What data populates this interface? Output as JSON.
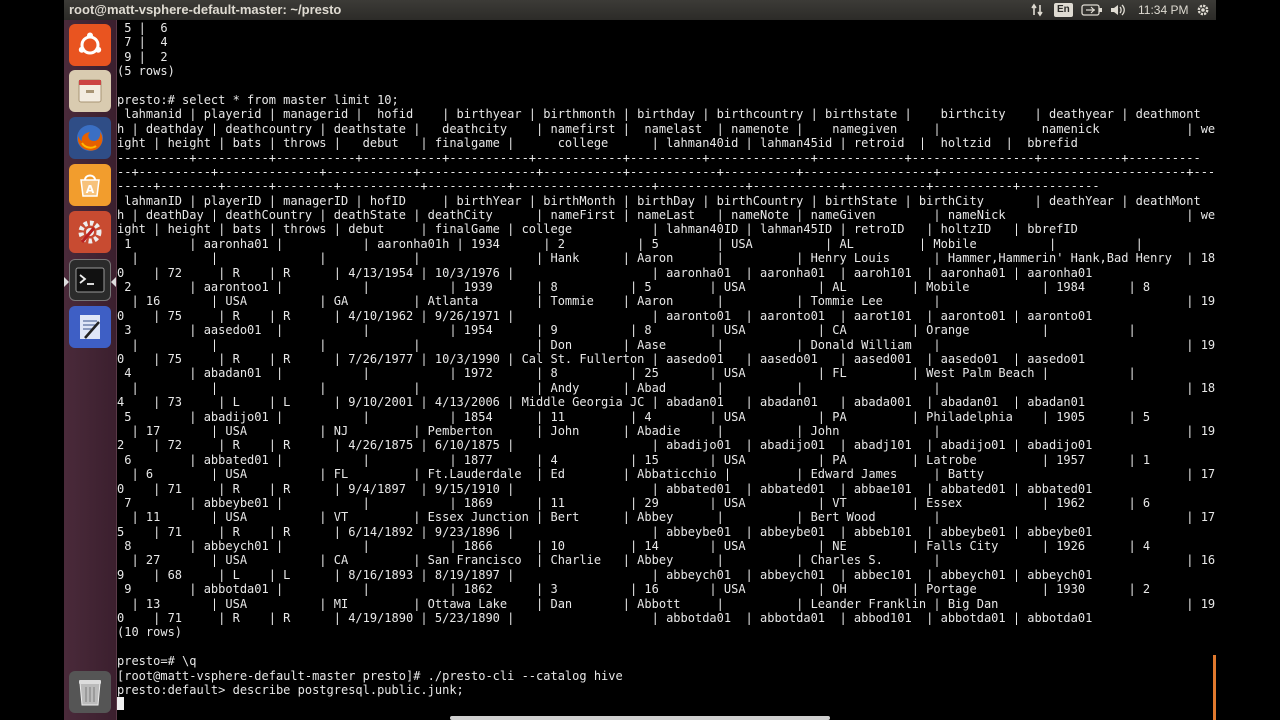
{
  "window": {
    "title": "root@matt-vsphere-default-master: ~/presto"
  },
  "tray": {
    "keyboard_layout": "En",
    "time": "11:34 PM",
    "icons": [
      "network-arrows-icon",
      "keyboard-layout-icon",
      "battery-icon",
      "volume-icon",
      "gear-icon"
    ]
  },
  "launcher": {
    "items": [
      {
        "name": "ubuntu-dash",
        "icon": "ubuntu-logo-icon",
        "color": "#e95420"
      },
      {
        "name": "files",
        "icon": "file-cabinet-icon",
        "color": "#d9cbb0"
      },
      {
        "name": "firefox",
        "icon": "firefox-icon",
        "color": "#e66000"
      },
      {
        "name": "software-center",
        "icon": "software-center-icon",
        "color": "#f29d2d"
      },
      {
        "name": "system-settings",
        "icon": "settings-icon",
        "color": "#c84b31"
      },
      {
        "name": "terminal",
        "icon": "terminal-icon",
        "color": "#2b2b2b"
      },
      {
        "name": "text-editor",
        "icon": "text-editor-icon",
        "color": "#3e5fc5"
      },
      {
        "name": "trash",
        "icon": "trash-icon",
        "color": "#7a7a7a"
      }
    ]
  },
  "colors": {
    "terminal_bg": "#000000",
    "terminal_fg": "#e8e8e8",
    "launcher_bg": "#4a2a3a",
    "topbar_bg": "#3c3b37",
    "accent": "#e0792e"
  },
  "terminal": {
    "lines": [
      " 5 |  6",
      " 7 |  4",
      " 9 |  2",
      "(5 rows)",
      "",
      "presto:# select * from master limit 10;",
      " lahmanid | playerid | managerid |  hofid    | birthyear | birthmonth | birthday | birthcountry | birthstate |    birthcity    | deathyear | deathmont",
      "h | deathday | deathcountry | deathstate |   deathcity    | namefirst |  namelast  | namenote |    namegiven     |              namenick            | we",
      "ight | height | bats | throws |   debut   | finalgame |      college      | lahman40id | lahman45id | retroid  |  holtzid  |  bbrefid",
      "----------+----------+-----------+-----------+-----------+------------+----------+--------------+------------+-----------------+-----------+----------",
      "--+----------+--------------+------------+----------------+-----------+------------+----------+------------------+----------------------------------+---",
      "-----+--------+------+--------+-----------+-----------+-------------------+------------+------------+-----------+-----------+-----------",
      " lahmanID | playerID | managerID | hofID     | birthYear | birthMonth | birthDay | birthCountry | birthState | birthCity       | deathYear | deathMont",
      "h | deathDay | deathCountry | deathState | deathCity      | nameFirst | nameLast   | nameNote | nameGiven        | nameNick                         | we",
      "ight | height | bats | throws | debut     | finalGame | college           | lahman40ID | lahman45ID | retroID   | holtzID   | bbrefID",
      " 1        | aaronha01 |           | aaronha01h | 1934      | 2          | 5        | USA          | AL         | Mobile          |           |",
      "  |          |              |            |                | Hank      | Aaron      |          | Henry Louis      | Hammer,Hammerin' Hank,Bad Henry  | 18",
      "0    | 72     | R    | R      | 4/13/1954 | 10/3/1976 |                   | aaronha01  | aaronha01  | aaroh101  | aaronha01 | aaronha01",
      " 2        | aarontoo1 |           |           | 1939      | 8          | 5        | USA          | AL         | Mobile          | 1984      | 8",
      "  | 16       | USA          | GA         | Atlanta        | Tommie    | Aaron      |          | Tommie Lee       |                                  | 19",
      "0    | 75     | R    | R      | 4/10/1962 | 9/26/1971 |                   | aaronto01  | aaronto01  | aarot101  | aaronto01 | aaronto01",
      " 3        | aasedo01  |           |           | 1954      | 9          | 8        | USA          | CA         | Orange          |           |",
      "  |          |              |            |                | Don       | Aase       |          | Donald William   |                                  | 19",
      "0    | 75     | R    | R      | 7/26/1977 | 10/3/1990 | Cal St. Fullerton | aasedo01   | aasedo01   | aased001  | aasedo01  | aasedo01",
      " 4        | abadan01  |           |           | 1972      | 8          | 25       | USA          | FL         | West Palm Beach |           |",
      "  |          |              |            |                | Andy      | Abad       |          |                  |                                  | 18",
      "4    | 73     | L    | L      | 9/10/2001 | 4/13/2006 | Middle Georgia JC | abadan01   | abadan01   | abada001  | abadan01  | abadan01",
      " 5        | abadijo01 |           |           | 1854      | 11         | 4        | USA          | PA         | Philadelphia    | 1905      | 5",
      "  | 17       | USA          | NJ         | Pemberton      | John      | Abadie     |          | John             |                                  | 19",
      "2    | 72     | R    | R      | 4/26/1875 | 6/10/1875 |                   | abadijo01  | abadijo01  | abadj101  | abadijo01 | abadijo01",
      " 6        | abbated01 |           |           | 1877      | 4          | 15       | USA          | PA         | Latrobe         | 1957      | 1",
      "  | 6        | USA          | FL         | Ft.Lauderdale  | Ed        | Abbaticchio |         | Edward James     | Batty                            | 17",
      "0    | 71     | R    | R      | 9/4/1897  | 9/15/1910 |                   | abbated01  | abbated01  | abbae101  | abbated01 | abbated01",
      " 7        | abbeybe01 |           |           | 1869      | 11         | 29       | USA          | VT         | Essex           | 1962      | 6",
      "  | 11       | USA          | VT         | Essex Junction | Bert      | Abbey      |          | Bert Wood        |                                  | 17",
      "5    | 71     | R    | R      | 6/14/1892 | 9/23/1896 |                   | abbeybe01  | abbeybe01  | abbeb101  | abbeybe01 | abbeybe01",
      " 8        | abbeych01 |           |           | 1866      | 10         | 14       | USA          | NE         | Falls City      | 1926      | 4",
      "  | 27       | USA          | CA         | San Francisco  | Charlie   | Abbey      |          | Charles S.       |                                  | 16",
      "9    | 68     | L    | L      | 8/16/1893 | 8/19/1897 |                   | abbeych01  | abbeych01  | abbec101  | abbeych01 | abbeych01",
      " 9        | abbotda01 |           |           | 1862      | 3          | 16       | USA          | OH         | Portage         | 1930      | 2",
      "  | 13       | USA          | MI         | Ottawa Lake    | Dan       | Abbott     |          | Leander Franklin | Big Dan                          | 19",
      "0    | 71     | R    | R      | 4/19/1890 | 5/23/1890 |                   | abbotda01  | abbotda01  | abbod101  | abbotda01 | abbotda01",
      "(10 rows)",
      "",
      "presto=# \\q",
      "[root@matt-vsphere-default-master presto]# ./presto-cli --catalog hive",
      "presto:default> describe postgresql.public.junk;"
    ]
  }
}
